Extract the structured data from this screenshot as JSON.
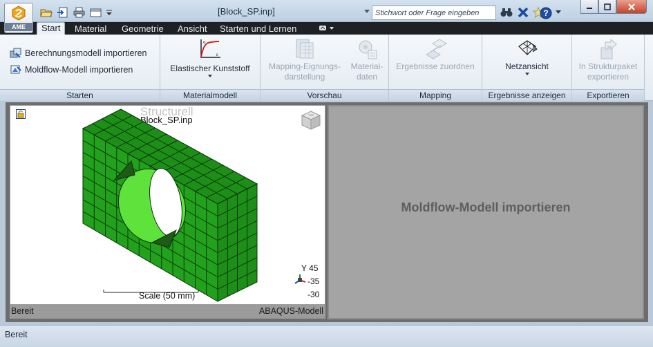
{
  "window": {
    "title": "[Block_SP.inp]",
    "search_placeholder": "Stichwort oder Frage eingeben",
    "app_button_label": "AME"
  },
  "tabs": [
    "Start",
    "Material",
    "Geometrie",
    "Ansicht",
    "Starten und Lernen"
  ],
  "ribbon": {
    "panels": {
      "starten": {
        "label": "Starten",
        "items": [
          "Berechnungsmodell importieren",
          "Moldflow-Modell importieren"
        ]
      },
      "materialmodell": {
        "label": "Materialmodell",
        "button": "Elastischer Kunststoff"
      },
      "vorschau": {
        "label": "Vorschau",
        "btn1_line1": "Mapping-Eignungs-",
        "btn1_line2": "darstellung",
        "btn2_line1": "Material-",
        "btn2_line2": "daten"
      },
      "mapping": {
        "label": "Mapping",
        "button": "Ergebnisse zuordnen"
      },
      "ergebnisse": {
        "label": "Ergebnisse anzeigen",
        "button": "Netzansicht"
      },
      "exportieren": {
        "label": "Exportieren",
        "btn_line1": "In Strukturpaket",
        "btn_line2": "exportieren"
      }
    }
  },
  "viewport": {
    "heading": "Structurell",
    "file": "Block_SP.inp",
    "scale": "Scale (50 mm)",
    "axis_y": "Y  45",
    "axis_z": "-35",
    "axis_x": "-30",
    "status_left": "Bereit",
    "status_right": "ABAQUS-Modell"
  },
  "right_pane": {
    "message": "Moldflow-Modell importieren"
  },
  "statusbar": {
    "text": "Bereit"
  },
  "colors": {
    "mesh_front": "#22a11c",
    "mesh_top": "#1d8f18",
    "mesh_inner": "#5fe23b",
    "mesh_lines": "#0b2f09"
  }
}
